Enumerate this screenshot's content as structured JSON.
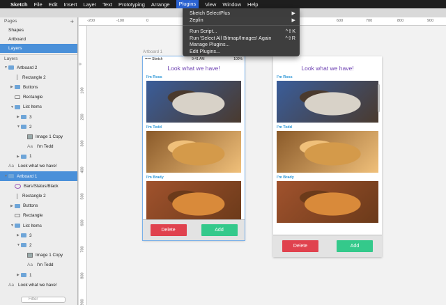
{
  "menubar": {
    "apple": "",
    "app": "Sketch",
    "items": [
      "File",
      "Edit",
      "Insert",
      "Layer",
      "Text",
      "Prototyping",
      "Arrange"
    ],
    "active": "Plugins",
    "items_after": [
      "View",
      "Window",
      "Help"
    ]
  },
  "plugins_menu": {
    "items": [
      {
        "label": "Sketch SelectPlus",
        "sub": "▶"
      },
      {
        "label": "Zeplin",
        "sub": "▶"
      }
    ],
    "items2": [
      {
        "label": "Run Script...",
        "sc": "^⇧K"
      },
      {
        "label": "Run 'Select All Bitmap/Images' Again",
        "sc": "^⇧R"
      },
      {
        "label": "Manage Plugins...",
        "sc": ""
      },
      {
        "label": "Edit Plugins...",
        "sc": ""
      }
    ]
  },
  "sidebar": {
    "pages_header": "Pages",
    "add": "+",
    "pages": [
      "Shapes",
      "Artboard",
      "Layers"
    ],
    "selected_page": "Layers",
    "layers_header": "Layers",
    "layers": [
      {
        "label": "Artboard 2",
        "ic": "folder",
        "ind": 0,
        "tri": "▼"
      },
      {
        "label": "Rectangle 2",
        "ic": "line",
        "ind": 1,
        "tri": ""
      },
      {
        "label": "Buttons",
        "ic": "folder",
        "ind": 1,
        "tri": "▶"
      },
      {
        "label": "Rectangle",
        "ic": "rect",
        "ind": 1,
        "tri": ""
      },
      {
        "label": "List Items",
        "ic": "folder",
        "ind": 1,
        "tri": "▼"
      },
      {
        "label": "3",
        "ic": "folder",
        "ind": 2,
        "tri": "▶"
      },
      {
        "label": "2",
        "ic": "folder",
        "ind": 2,
        "tri": "▼"
      },
      {
        "label": "Image 1 Copy",
        "ic": "img",
        "ind": 3,
        "tri": ""
      },
      {
        "label": "I'm Tedd",
        "ic": "txt",
        "ind": 3,
        "tri": ""
      },
      {
        "label": "1",
        "ic": "folder",
        "ind": 2,
        "tri": "▶"
      },
      {
        "label": "Look what we have!",
        "ic": "txt",
        "ind": 0,
        "tri": ""
      },
      {
        "label": "Artboard 1",
        "ic": "folder",
        "ind": 0,
        "tri": "▼",
        "sel": true
      },
      {
        "label": "Bars/Status/Black",
        "ic": "sym",
        "ind": 1,
        "tri": ""
      },
      {
        "label": "Rectangle 2",
        "ic": "line",
        "ind": 1,
        "tri": ""
      },
      {
        "label": "Buttons",
        "ic": "folder",
        "ind": 1,
        "tri": "▶"
      },
      {
        "label": "Rectangle",
        "ic": "rect",
        "ind": 1,
        "tri": ""
      },
      {
        "label": "List Items",
        "ic": "folder",
        "ind": 1,
        "tri": "▼"
      },
      {
        "label": "3",
        "ic": "folder",
        "ind": 2,
        "tri": "▶"
      },
      {
        "label": "2",
        "ic": "folder",
        "ind": 2,
        "tri": "▼"
      },
      {
        "label": "Image 1 Copy",
        "ic": "img",
        "ind": 3,
        "tri": ""
      },
      {
        "label": "I'm Tedd",
        "ic": "txt",
        "ind": 3,
        "tri": ""
      },
      {
        "label": "1",
        "ic": "folder",
        "ind": 2,
        "tri": "▶"
      },
      {
        "label": "Look what we have!",
        "ic": "txt",
        "ind": 0,
        "tri": ""
      }
    ],
    "filter_placeholder": "Filter"
  },
  "ruler_top": [
    "-200",
    "-100",
    "0",
    "600",
    "700",
    "800",
    "900"
  ],
  "ruler_left": [
    "0",
    "100",
    "200",
    "300",
    "400",
    "500",
    "600",
    "700",
    "800",
    "900"
  ],
  "artboard1": {
    "name": "Artboard 1",
    "status_left": "••••• Sketch",
    "status_time": "9:41 AM",
    "status_right": "100%",
    "title": "Look what we have!",
    "items": [
      "I'm Ross",
      "I'm Tedd",
      "I'm Brady"
    ],
    "delete": "Delete",
    "add": "Add"
  },
  "artboard2": {
    "title": "Look what we have!",
    "items": [
      "I'm Ross",
      "I'm Tedd",
      "I'm Brady"
    ],
    "delete": "Delete",
    "add": "Add"
  }
}
